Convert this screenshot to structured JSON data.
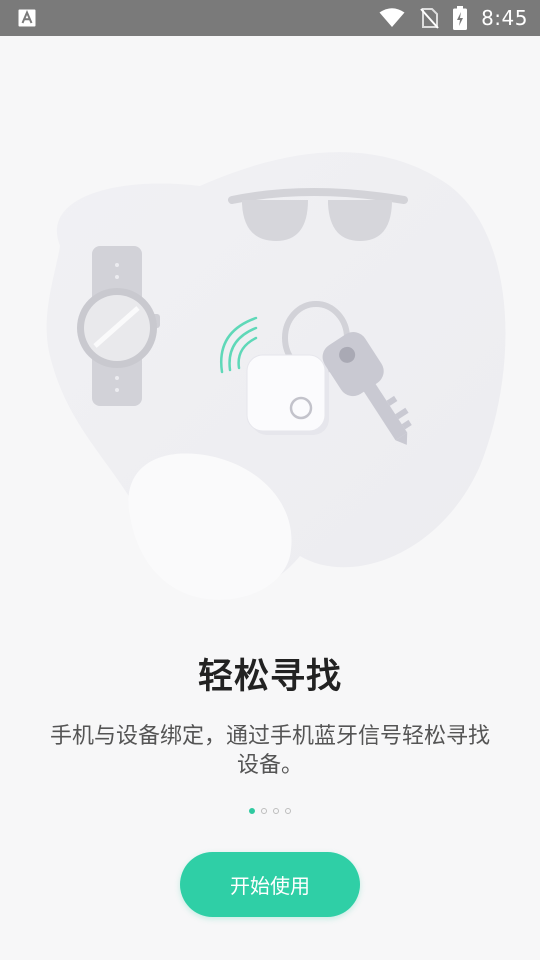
{
  "status_bar": {
    "time": "8:45",
    "icons": [
      "a-icon",
      "wifi-icon",
      "no-sim-icon",
      "battery-icon"
    ]
  },
  "onboarding": {
    "title": "轻松寻找",
    "description": "手机与设备绑定，通过手机蓝牙信号轻松寻找设备。",
    "page_indicator": {
      "total": 4,
      "current": 1
    },
    "start_button_label": "开始使用",
    "accent_color": "#2fcfa6"
  }
}
